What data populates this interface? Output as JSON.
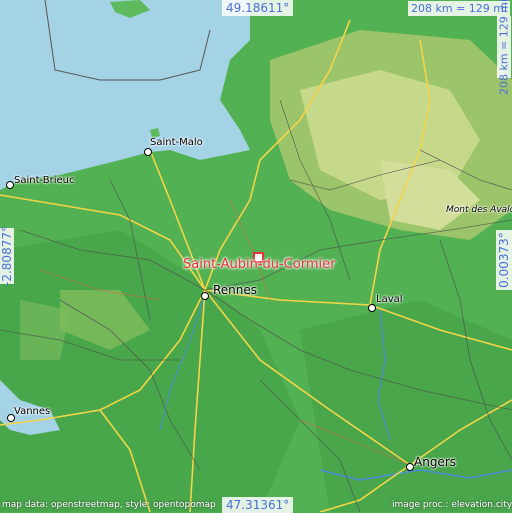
{
  "coordinates": {
    "top": "49.18611°",
    "bottom": "47.31361°",
    "left": "-2.80877°",
    "right": "0.00373°"
  },
  "scale": {
    "horizontal": "208 km = 129 mi",
    "vertical": "208 km = 129 mi"
  },
  "target": {
    "name": "Saint-Aubin-du-Cormier",
    "color": "#e8333a"
  },
  "places": [
    {
      "id": "saint-malo",
      "name": "Saint-Malo"
    },
    {
      "id": "saint-brieuc",
      "name": "Saint-Brieuc"
    },
    {
      "id": "rennes",
      "name": "Rennes"
    },
    {
      "id": "laval",
      "name": "Laval"
    },
    {
      "id": "vannes",
      "name": "Vannes"
    },
    {
      "id": "angers",
      "name": "Angers"
    },
    {
      "id": "mont-des-avaloirs",
      "name": "Mont des Avalo"
    }
  ],
  "credits": {
    "left": "map data: openstreetmap, style: opentopomap",
    "right": "image proc.: elevation.city"
  },
  "colors": {
    "sea": "#a5d3e6",
    "lowland": "#4caf50",
    "upland": "#c9d98a",
    "road": "#f5d547",
    "text_accent": "#4a6fd8"
  }
}
